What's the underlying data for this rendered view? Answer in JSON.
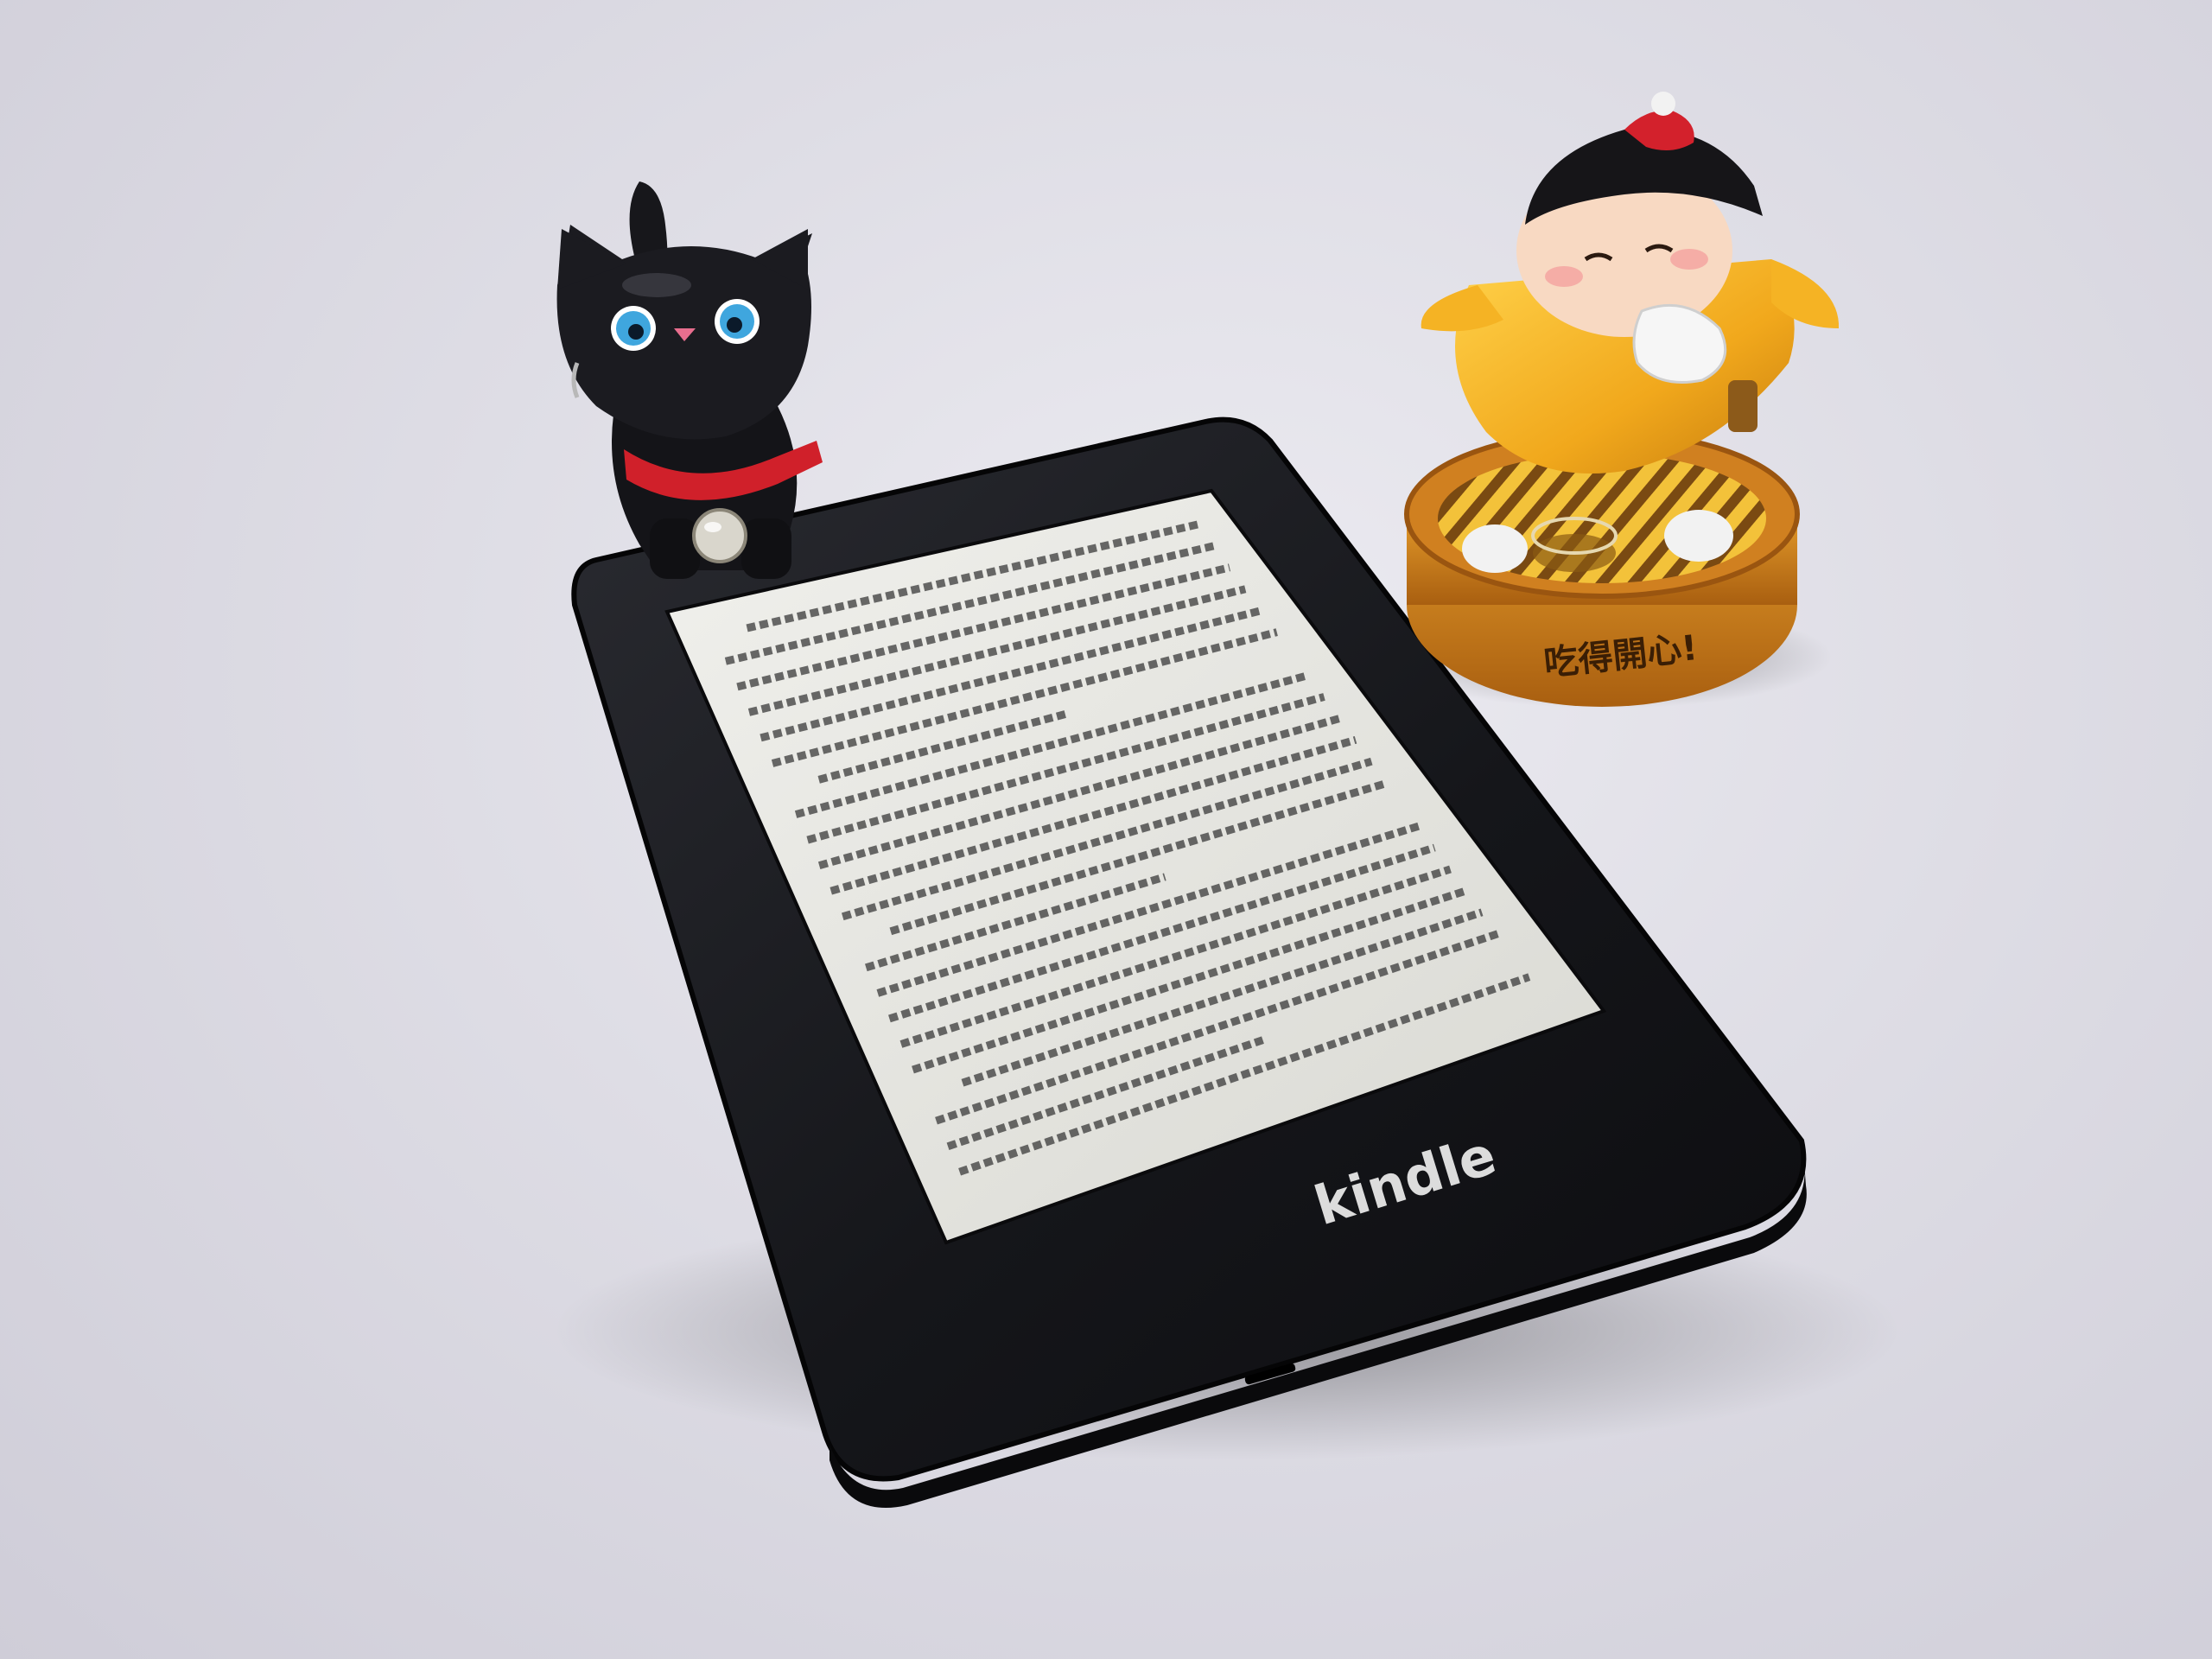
{
  "photo": {
    "background_color": "#e6e5ec",
    "objects": [
      "black-cat-figurine",
      "ereader-device",
      "yellow-doll-figurine"
    ]
  },
  "ereader": {
    "brand_label": "kindle",
    "body_color": "#15161a",
    "screen_color": "#e7e7e2",
    "screen_text_lines": 22
  },
  "cat_figurine": {
    "body_color": "#17171b",
    "eye_color": "#3fa6de",
    "collar_color": "#d0202a"
  },
  "doll_figurine": {
    "body_color": "#f1a81c",
    "base_color": "#c9771a",
    "base_text": "吃得開心!"
  }
}
